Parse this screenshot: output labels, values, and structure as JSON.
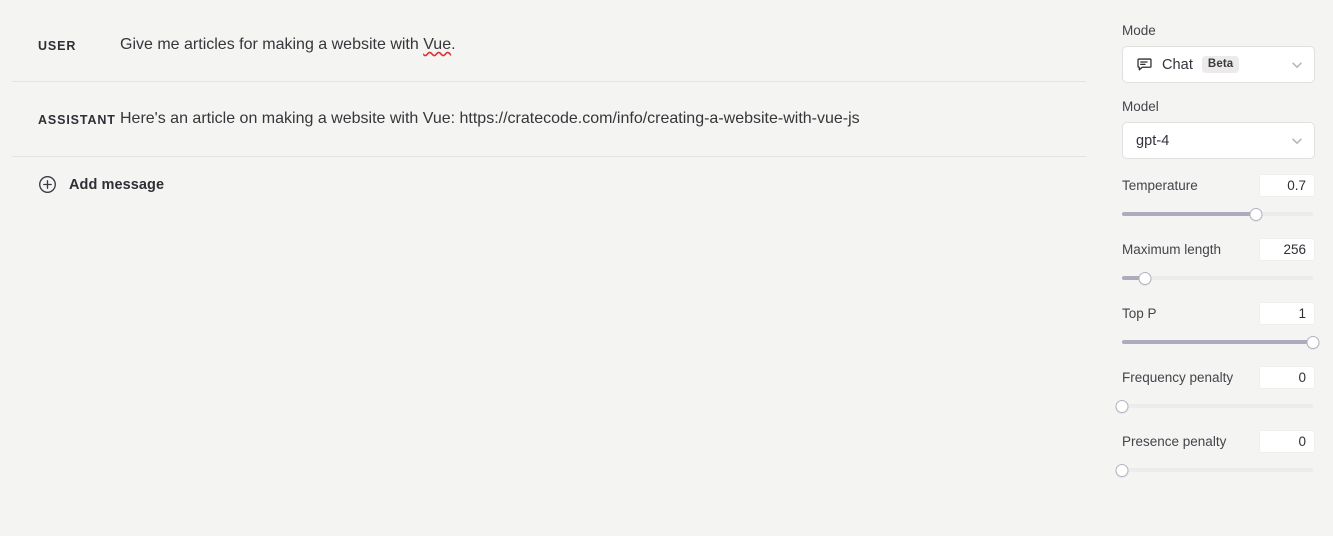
{
  "chat": {
    "messages": [
      {
        "role": "USER",
        "text_before": "Give me articles for making a website with ",
        "misspelled": "Vue",
        "text_after": "."
      },
      {
        "role": "ASSISTANT",
        "text": "Here's an article on making a website with Vue: https://cratecode.com/info/creating-a-website-with-vue-js"
      }
    ],
    "add_message_label": "Add message"
  },
  "sidebar": {
    "mode": {
      "label": "Mode",
      "value": "Chat",
      "badge": "Beta",
      "icon": "chat-bubble-icon"
    },
    "model": {
      "label": "Model",
      "value": "gpt-4"
    },
    "sliders": [
      {
        "label": "Temperature",
        "value": "0.7",
        "percent": 70
      },
      {
        "label": "Maximum length",
        "value": "256",
        "percent": 12
      },
      {
        "label": "Top P",
        "value": "1",
        "percent": 100
      },
      {
        "label": "Frequency penalty",
        "value": "0",
        "percent": 0
      },
      {
        "label": "Presence penalty",
        "value": "0",
        "percent": 0
      }
    ]
  },
  "colors": {
    "page_background": "#f4f4f2",
    "slider_fill": "#adabbd",
    "slider_rail": "#ececee",
    "text_primary": "#32323a",
    "spellcheck_underline": "#e02f2f"
  }
}
